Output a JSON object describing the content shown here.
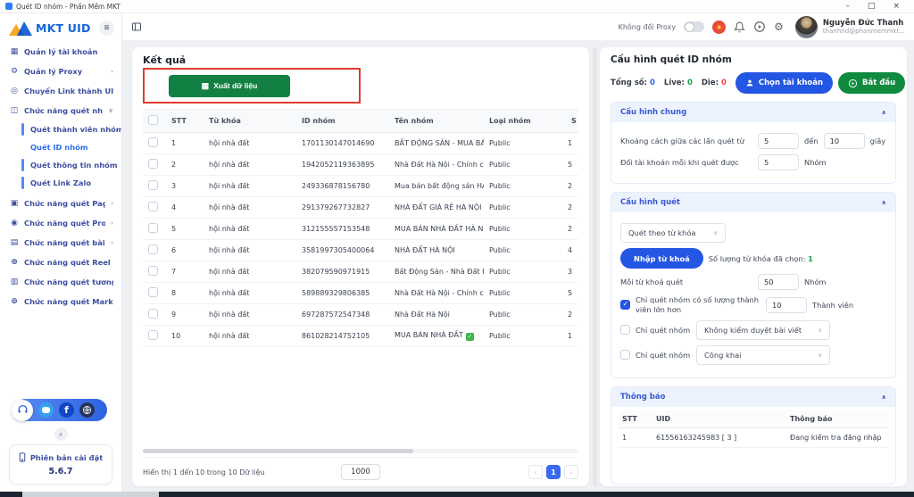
{
  "window": {
    "title": "Quét ID nhóm - Phần Mềm MKT",
    "minimize": "–",
    "maximize": "□",
    "close": "×"
  },
  "sidebar": {
    "logo_text": "MKT UID",
    "items": [
      {
        "label": "Quản lý tài khoản",
        "icon": "▦",
        "icon_name": "accounts-grid-icon"
      },
      {
        "label": "Quản lý Proxy",
        "icon": "⚙",
        "icon_name": "proxy-gear-icon",
        "chevron": "›"
      },
      {
        "label": "Chuyển Link thành UID",
        "icon": "◎",
        "icon_name": "link-to-uid-icon"
      },
      {
        "label": "Chức năng quét nhóm",
        "icon": "◫",
        "icon_name": "group-scan-icon",
        "chevron": "∨",
        "children": [
          {
            "label": "Quét thành viên nhóm"
          },
          {
            "label": "Quét ID nhóm",
            "active": true
          },
          {
            "label": "Quét thông tin nhóm"
          },
          {
            "label": "Quét Link Zalo"
          }
        ]
      },
      {
        "label": "Chức năng quét Page",
        "icon": "▣",
        "icon_name": "page-scan-icon",
        "chevron": "›"
      },
      {
        "label": "Chức năng quét Profile",
        "icon": "◉",
        "icon_name": "profile-scan-icon",
        "chevron": "›"
      },
      {
        "label": "Chức năng quét bài viết",
        "icon": "▤",
        "icon_name": "post-scan-icon",
        "chevron": "›"
      },
      {
        "label": "Chức năng quét Reel",
        "icon": "⊛",
        "icon_name": "reel-scan-icon"
      },
      {
        "label": "Chức năng quét tương tác",
        "icon": "▥",
        "icon_name": "interaction-scan-icon"
      },
      {
        "label": "Chức năng quét Marketplace",
        "icon": "⊚",
        "icon_name": "marketplace-scan-icon"
      }
    ],
    "facebook_letter": "f",
    "version_label": "Phiên bản cài đặt",
    "version_number": "5.6.7"
  },
  "topbar": {
    "proxy_label": "Không đổi Proxy",
    "user_name": "Nguyễn Đức Thanh",
    "user_email": "thanhnd@phanmemmkt..."
  },
  "results": {
    "title": "Kết quả",
    "export_label": "Xuất dữ liệu",
    "headers": {
      "stt": "STT",
      "keyword": "Từ khóa",
      "id": "ID nhóm",
      "name": "Tên nhóm",
      "type": "Loại nhóm",
      "members": "S"
    },
    "rows": [
      {
        "stt": "1",
        "keyword": "hội nhà đất",
        "id": "1701130147014690",
        "name": "BẤT ĐỘNG SẢN - MUA BÁ...",
        "type": "Public",
        "members": "1",
        "verified": false
      },
      {
        "stt": "2",
        "keyword": "hội nhà đất",
        "id": "1942052119363895",
        "name": "Nhà Đất Hà Nội - Chính chủ",
        "type": "Public",
        "members": "5",
        "verified": false
      },
      {
        "stt": "3",
        "keyword": "hội nhà đất",
        "id": "249336878156780",
        "name": "Mua bán bất động sản HÀ ...",
        "type": "Public",
        "members": "2",
        "verified": false
      },
      {
        "stt": "4",
        "keyword": "hội nhà đất",
        "id": "291379267732827",
        "name": "NHÀ ĐẤT GIÁ RẺ HÀ NỘI",
        "type": "Public",
        "members": "2",
        "verified": false
      },
      {
        "stt": "5",
        "keyword": "hội nhà đất",
        "id": "312155557153548",
        "name": "MUA BÁN NHÀ ĐẤT HÀ NỘI",
        "type": "Public",
        "members": "2",
        "verified": false
      },
      {
        "stt": "6",
        "keyword": "hội nhà đất",
        "id": "3581997305400064",
        "name": "NHÀ ĐẤT HÀ NỘI",
        "type": "Public",
        "members": "4",
        "verified": false
      },
      {
        "stt": "7",
        "keyword": "hội nhà đất",
        "id": "382079590971915",
        "name": "Bất Động Sản - Nhà Đất H...",
        "type": "Public",
        "members": "3",
        "verified": false
      },
      {
        "stt": "8",
        "keyword": "hội nhà đất",
        "id": "589889329806385",
        "name": "Nhà Đất Hà Nội - Chính chủ",
        "type": "Public",
        "members": "5",
        "verified": false
      },
      {
        "stt": "9",
        "keyword": "hội nhà đất",
        "id": "697287572547348",
        "name": "Nhà Đất Hà Nội",
        "type": "Public",
        "members": "2",
        "verified": false
      },
      {
        "stt": "10",
        "keyword": "hội nhà đất",
        "id": "861028214752105",
        "name": "MUA BÁN NHÀ ĐẤT",
        "type": "Public",
        "members": "1",
        "verified": true
      }
    ],
    "footer_text": "Hiển thị 1 đến 10 trong 10 Dữ liệu",
    "page_size": "1000",
    "prev": "‹",
    "page": "1",
    "next": "›"
  },
  "config": {
    "title": "Cấu hình quét ID nhóm",
    "stats": {
      "total_label": "Tổng số:",
      "total": "0",
      "live_label": "Live:",
      "live": "0",
      "die_label": "Die:",
      "die": "0"
    },
    "choose_account": "Chọn tài khoản",
    "start": "Bắt đầu",
    "general": {
      "header": "Cấu hình chung",
      "row1_label": "Khoảng cách giữa các lần quét từ",
      "from": "5",
      "between": "đến",
      "to": "10",
      "unit1": "giây",
      "row2_label": "Đổi tài khoản mỗi khi quét được",
      "count": "5",
      "unit2": "Nhóm"
    },
    "scan": {
      "header": "Cấu hình quét",
      "mode": "Quét theo từ khóa",
      "keyword_button": "Nhập từ khoá",
      "selected_label": "Số lượng từ khóa đã chọn:",
      "selected_count": "1",
      "per_label": "Mỗi từ khoá quét",
      "per_value": "50",
      "per_unit": "Nhóm",
      "member_label": "Chỉ quét nhóm có số lượng thành viên lớn hơn",
      "member_value": "10",
      "member_unit": "Thành viên",
      "filter_label1": "Chỉ quét nhóm",
      "filter_value1": "Không kiểm duyệt bài viết",
      "filter_label2": "Chỉ quét nhóm",
      "filter_value2": "Công khai"
    },
    "notifications": {
      "header": "Thông báo",
      "h_stt": "STT",
      "h_uid": "UID",
      "h_msg": "Thông báo",
      "rows": [
        {
          "stt": "1",
          "uid": "61556163245983 [ 3 ]",
          "msg": "Đang kiểm tra đăng nhập"
        }
      ]
    }
  },
  "colors": {
    "accent_blue": "#2456e4",
    "accent_green": "#128042",
    "annotation_red": "#e23b30"
  }
}
